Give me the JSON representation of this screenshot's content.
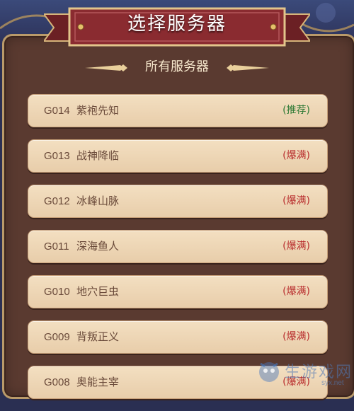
{
  "header": {
    "title": "选择服务器"
  },
  "panel": {
    "subtitle": "所有服务器"
  },
  "servers": [
    {
      "code": "G014",
      "name": "紫袍先知",
      "status": "(推荐)",
      "status_type": "recommend"
    },
    {
      "code": "G013",
      "name": "战神降临",
      "status": "(爆满)",
      "status_type": "full"
    },
    {
      "code": "G012",
      "name": "冰峰山脉",
      "status": "(爆满)",
      "status_type": "full"
    },
    {
      "code": "G011",
      "name": "深海鱼人",
      "status": "(爆满)",
      "status_type": "full"
    },
    {
      "code": "G010",
      "name": "地穴巨虫",
      "status": "(爆满)",
      "status_type": "full"
    },
    {
      "code": "G009",
      "name": "背叛正义",
      "status": "(爆满)",
      "status_type": "full"
    },
    {
      "code": "G008",
      "name": "奥能主宰",
      "status": "(爆满)",
      "status_type": "full"
    }
  ],
  "watermark": {
    "text": "生游戏网",
    "url": "syx.net"
  },
  "colors": {
    "panel_bg": "#5a3a30",
    "row_bg": "#f3dfc1",
    "ribbon": "#7c2a2e",
    "status_recommend": "#2f7a35",
    "status_full": "#b92f2f"
  }
}
